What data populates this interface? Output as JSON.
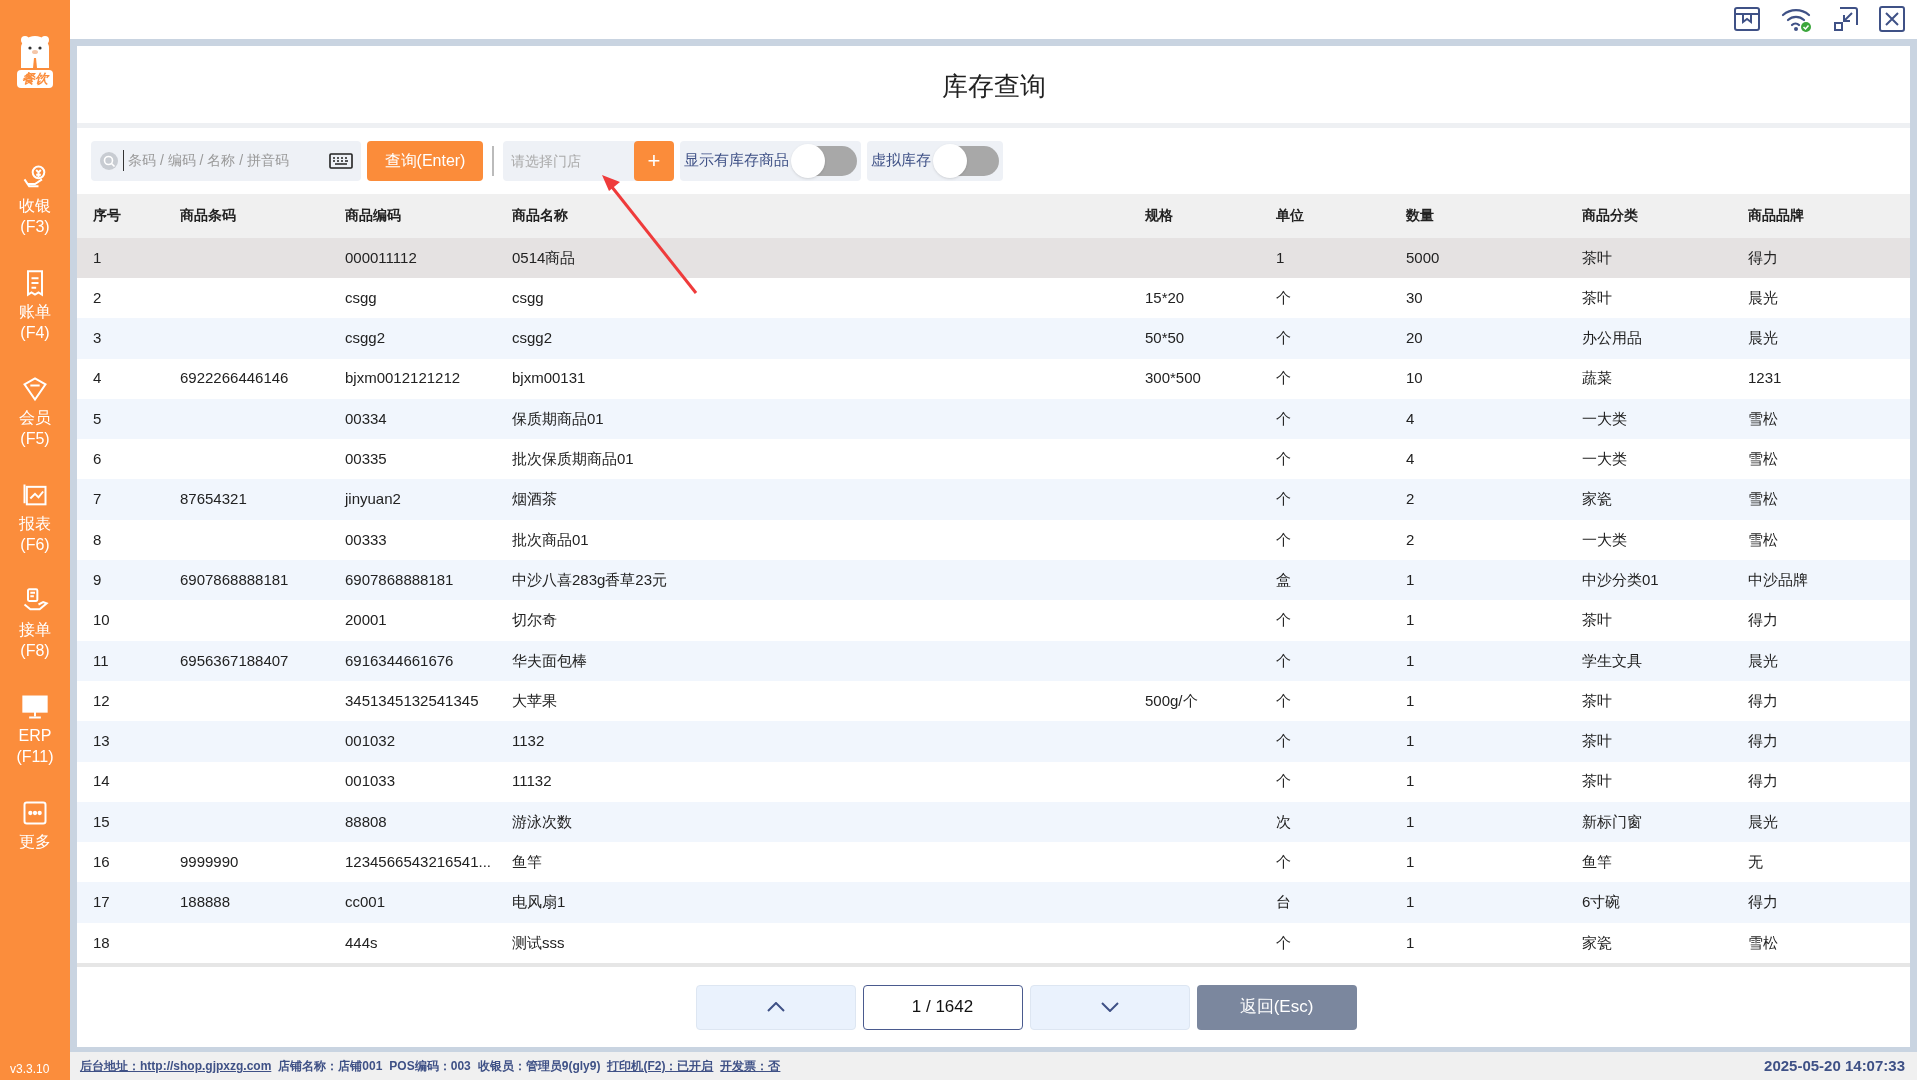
{
  "sidebar": {
    "logo_text": "餐饮",
    "items": [
      {
        "label": "收银",
        "key": "(F3)"
      },
      {
        "label": "账单",
        "key": "(F4)"
      },
      {
        "label": "会员",
        "key": "(F5)"
      },
      {
        "label": "报表",
        "key": "(F6)"
      },
      {
        "label": "接单",
        "key": "(F8)"
      },
      {
        "label": "ERP",
        "key": "(F11)"
      },
      {
        "label": "更多"
      }
    ],
    "version": "v3.3.10"
  },
  "page_title": "库存查询",
  "toolbar": {
    "search": {
      "placeholder": "条码 / 编码 / 名称 / 拼音码"
    },
    "query_button": "查询(Enter)",
    "store": {
      "placeholder": "请选择门店"
    },
    "add_button": "+",
    "toggles": [
      {
        "label": "显示有库存商品",
        "on": false
      },
      {
        "label": "虚拟库存",
        "on": false
      }
    ]
  },
  "table": {
    "columns": [
      "序号",
      "商品条码",
      "商品编码",
      "商品名称",
      "规格",
      "单位",
      "数量",
      "商品分类",
      "商品品牌"
    ],
    "rows": [
      {
        "selected": true,
        "cells": [
          "1",
          "",
          "000011112",
          "0514商品",
          "",
          "1",
          "5000",
          "茶叶",
          "得力"
        ]
      },
      {
        "selected": false,
        "cells": [
          "2",
          "",
          "csgg",
          "csgg",
          "15*20",
          "个",
          "30",
          "茶叶",
          "晨光"
        ]
      },
      {
        "selected": false,
        "cells": [
          "3",
          "",
          "csgg2",
          "csgg2",
          "50*50",
          "个",
          "20",
          "办公用品",
          "晨光"
        ]
      },
      {
        "selected": false,
        "cells": [
          "4",
          "6922266446146",
          "bjxm0012121212",
          "bjxm00131",
          "300*500",
          "个",
          "10",
          "蔬菜",
          "1231"
        ]
      },
      {
        "selected": false,
        "cells": [
          "5",
          "",
          "00334",
          "保质期商品01",
          "",
          "个",
          "4",
          "一大类",
          "雪松"
        ]
      },
      {
        "selected": false,
        "cells": [
          "6",
          "",
          "00335",
          "批次保质期商品01",
          "",
          "个",
          "4",
          "一大类",
          "雪松"
        ]
      },
      {
        "selected": false,
        "cells": [
          "7",
          "87654321",
          "jinyuan2",
          "烟酒茶",
          "",
          "个",
          "2",
          "家瓷",
          "雪松"
        ]
      },
      {
        "selected": false,
        "cells": [
          "8",
          "",
          "00333",
          "批次商品01",
          "",
          "个",
          "2",
          "一大类",
          "雪松"
        ]
      },
      {
        "selected": false,
        "cells": [
          "9",
          "6907868888181",
          "6907868888181",
          "中沙八喜283g香草23元",
          "",
          "盒",
          "1",
          "中沙分类01",
          "中沙品牌"
        ]
      },
      {
        "selected": false,
        "cells": [
          "10",
          "",
          "20001",
          "切尔奇",
          "",
          "个",
          "1",
          "茶叶",
          "得力"
        ]
      },
      {
        "selected": false,
        "cells": [
          "11",
          "6956367188407",
          "6916344661676",
          "华夫面包棒",
          "",
          "个",
          "1",
          "学生文具",
          "晨光"
        ]
      },
      {
        "selected": false,
        "cells": [
          "12",
          "",
          "3451345132541345",
          "大苹果",
          "500g/个",
          "个",
          "1",
          "茶叶",
          "得力"
        ]
      },
      {
        "selected": false,
        "cells": [
          "13",
          "",
          "001032",
          "1132",
          "",
          "个",
          "1",
          "茶叶",
          "得力"
        ]
      },
      {
        "selected": false,
        "cells": [
          "14",
          "",
          "001033",
          "11132",
          "",
          "个",
          "1",
          "茶叶",
          "得力"
        ]
      },
      {
        "selected": false,
        "cells": [
          "15",
          "",
          "88808",
          "游泳次数",
          "",
          "次",
          "1",
          "新标门窗",
          "晨光"
        ]
      },
      {
        "selected": false,
        "cells": [
          "16",
          "9999990",
          "1234566543216541...",
          "鱼竿",
          "",
          "个",
          "1",
          "鱼竿",
          "无"
        ]
      },
      {
        "selected": false,
        "cells": [
          "17",
          "188888",
          "cc001",
          "电风扇1",
          "",
          "台",
          "1",
          "6寸碗",
          "得力"
        ]
      },
      {
        "selected": false,
        "cells": [
          "18",
          "",
          "444s",
          "测试sss",
          "",
          "个",
          "1",
          "家瓷",
          "雪松"
        ]
      }
    ]
  },
  "pagination": {
    "page": "1 / 1642",
    "back_button": "返回(Esc)"
  },
  "status_bar": {
    "items": [
      {
        "kind": "link",
        "text": "后台地址：http://shop.gjpxzg.com"
      },
      {
        "kind": "text",
        "text": "店铺名称：店铺001"
      },
      {
        "kind": "text",
        "text": "POS编码：003"
      },
      {
        "kind": "text",
        "text": "收银员：管理员9(gly9)"
      },
      {
        "kind": "link",
        "text": "打印机(F2)：已开启"
      },
      {
        "kind": "link",
        "text": "开发票：否"
      }
    ],
    "datetime": "2025-05-20 14:07:33"
  }
}
